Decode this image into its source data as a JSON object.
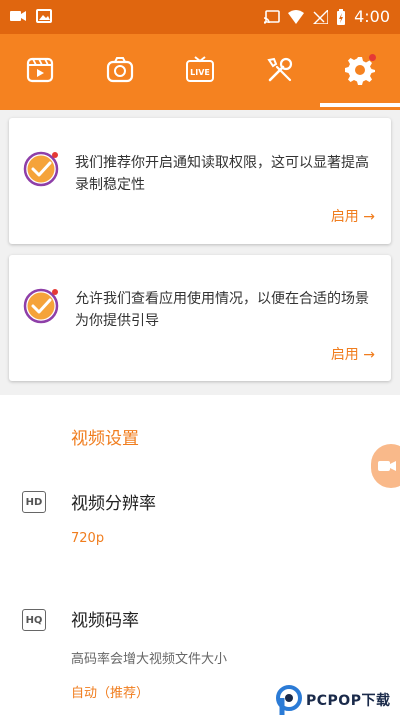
{
  "status_bar": {
    "time": "4:00",
    "icons": [
      "video-icon",
      "image-icon",
      "cast-icon",
      "wifi-icon",
      "signal-icon",
      "battery-charging-icon"
    ]
  },
  "toolbar": {
    "tabs": [
      {
        "icon": "video-list-icon",
        "active": false
      },
      {
        "icon": "screenshot-icon",
        "active": false
      },
      {
        "icon": "live-icon",
        "label": "LIVE",
        "active": false
      },
      {
        "icon": "tools-icon",
        "active": false
      },
      {
        "icon": "settings-gear-icon",
        "active": true,
        "badge": true
      }
    ],
    "accent": "#f58220"
  },
  "cards": [
    {
      "text": "我们推荐你开启通知读取权限，这可以显著提高录制稳定性",
      "action": "启用 →"
    },
    {
      "text": "允许我们查看应用使用情况，以便在合适的场景为你提供引导",
      "action": "启用 →"
    }
  ],
  "video_settings": {
    "section_title": "视频设置",
    "resolution": {
      "icon_label": "HD",
      "title": "视频分辨率",
      "value": "720p"
    },
    "bitrate": {
      "icon_label": "HQ",
      "title": "视频码率",
      "subtitle": "高码率会增大视频文件大小",
      "value": "自动（推荐）"
    }
  },
  "watermark": {
    "text": "PCPOP下载"
  },
  "colors": {
    "status_bar": "#e0660f",
    "toolbar": "#f58220",
    "accent_text": "#f07d1e"
  }
}
